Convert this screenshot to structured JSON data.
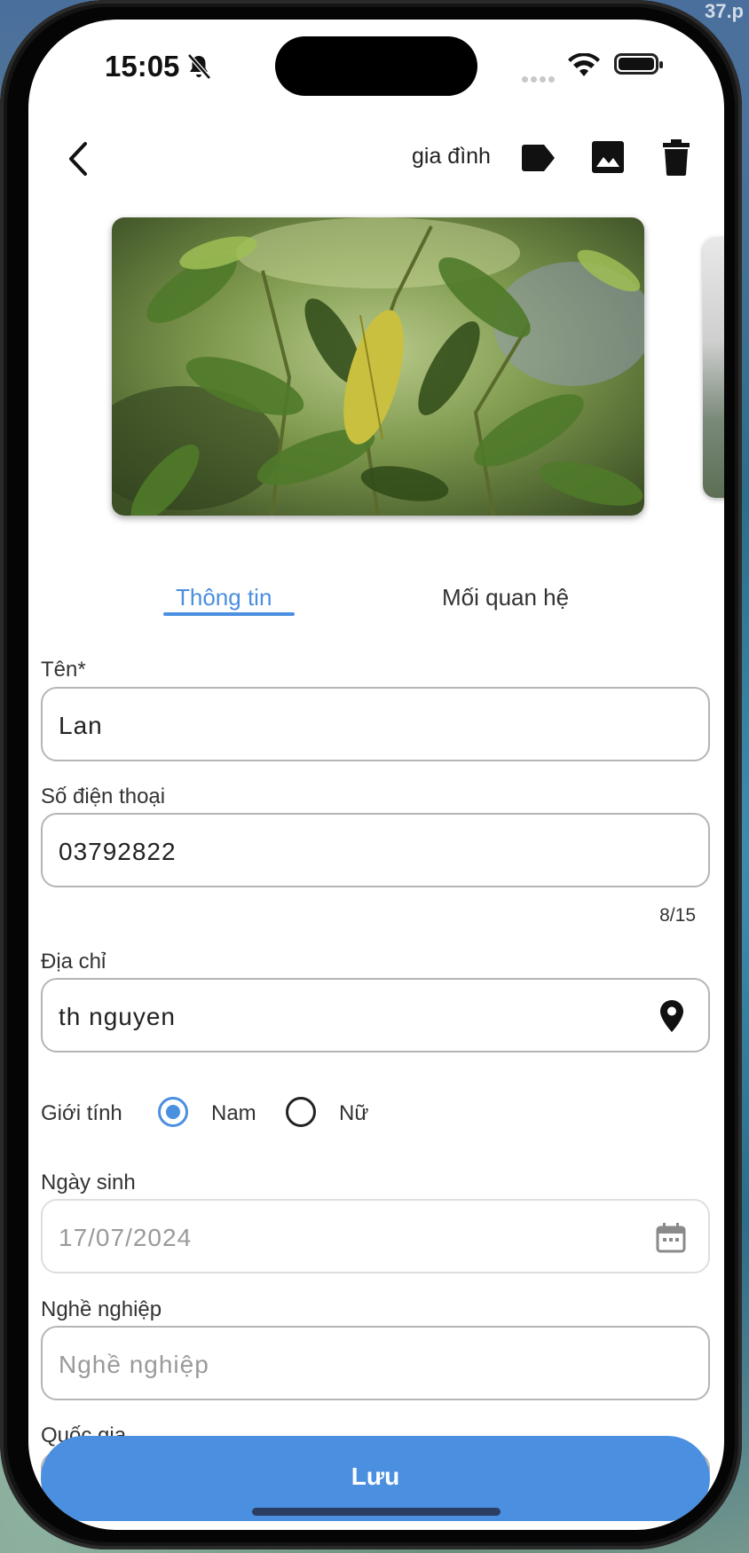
{
  "status_bar": {
    "time": "15:05"
  },
  "desktop": {
    "corner_text": "37.p"
  },
  "toolbar": {
    "tag_label": "gia đình"
  },
  "tabs": [
    {
      "label": "Thông tin",
      "active": true
    },
    {
      "label": "Mối quan hệ",
      "active": false
    }
  ],
  "form": {
    "name": {
      "label": "Tên*",
      "value": "Lan"
    },
    "phone": {
      "label": "Số điện thoại",
      "value": "03792822",
      "counter": "8/15"
    },
    "address": {
      "label": "Địa chỉ",
      "value": "th nguyen"
    },
    "gender": {
      "label": "Giới tính",
      "options": [
        "Nam",
        "Nữ"
      ],
      "selected": "Nam"
    },
    "birthday": {
      "label": "Ngày sinh",
      "value": "17/07/2024"
    },
    "occupation": {
      "label": "Nghề nghiệp",
      "placeholder": "Nghề nghiệp"
    },
    "country": {
      "label": "Quốc gia"
    }
  },
  "save_button": {
    "label": "Lưu"
  },
  "colors": {
    "accent": "#4a8fe0",
    "border": "#b5b5b5",
    "text": "#333333"
  },
  "icons": [
    "back-arrow-icon",
    "tag-icon",
    "image-icon",
    "trash-icon",
    "location-pin-icon",
    "calendar-icon",
    "bell-slash-icon",
    "wifi-icon",
    "battery-icon"
  ]
}
